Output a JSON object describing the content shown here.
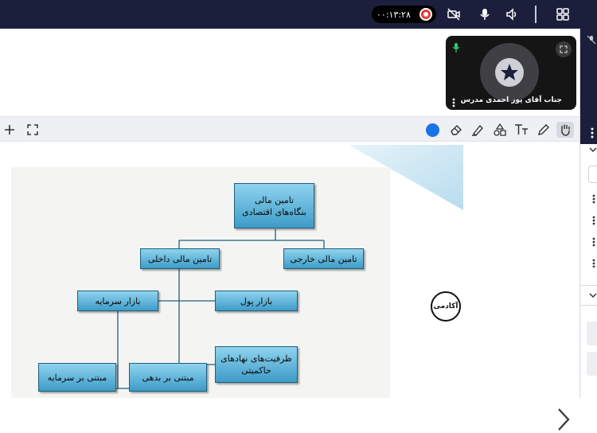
{
  "recording": {
    "timer": "۰۰:۱۳:۲۸"
  },
  "topbar_icons": [
    "record-icon",
    "camera-off-icon",
    "microphone-icon",
    "speaker-icon",
    "grid-icon"
  ],
  "video": {
    "presenter_name": "جناب آقای پور احمدی مدرس"
  },
  "toolbar": {
    "tools": [
      "add-icon",
      "fullscreen-icon",
      "color-picker",
      "eraser-icon",
      "highlighter-icon",
      "shapes-icon",
      "text-tool-icon",
      "pencil-icon",
      "hand-tool-icon"
    ],
    "active_color": "#1a73e8"
  },
  "slide": {
    "logo": "آکادمی",
    "nodes": {
      "root": "تامین مالی بنگاه‌های اقتصادی",
      "internal": "تامین مالی داخلی",
      "external": "تامین مالی خارجی",
      "capital_market": "بازار سرمایه",
      "money_market": "بازار پول",
      "sovereign": "ظرفیت‌های نهادهای حاکمیتی",
      "equity": "مبتنی بر سرمایه",
      "debt": "مبتنی بر بدهی"
    }
  },
  "colors": {
    "topbar": "#1b1f3b",
    "node_fill": "#5fb6dc",
    "record": "#e53935"
  }
}
